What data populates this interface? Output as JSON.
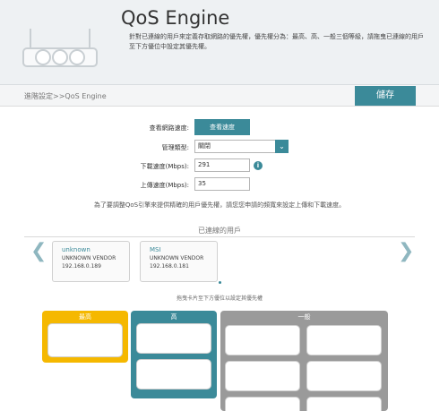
{
  "header": {
    "title": "QoS Engine",
    "description": "針對已連線的用戶來定義存取網路的優先權，優先權分為：最高、高、一般三個等級，請拖曳已連線的用戶至下方優位中設定其優先權。"
  },
  "breadcrumb": "進階設定>>QoS Engine",
  "toolbar": {
    "save_label": "儲存"
  },
  "form": {
    "check_speed_label": "查看網路速度:",
    "check_speed_button": "查看速度",
    "mgmt_type_label": "管理類型:",
    "mgmt_type_value": "關閉",
    "download_label": "下載速度(Mbps):",
    "download_value": "291",
    "upload_label": "上傳速度(Mbps):",
    "upload_value": "35",
    "note": "為了要調整QoS引擎來提供精確的用戶優先權，請您您申請的頻寬來設定上傳和下載速度。"
  },
  "clients": {
    "title": "已連線的用戶",
    "items": [
      {
        "name": "unknown",
        "vendor": "UNKNOWN VENDOR",
        "ip": "192.168.0.189"
      },
      {
        "name": "MSI",
        "vendor": "UNKNOWN VENDOR",
        "ip": "192.168.0.181"
      }
    ],
    "drag_hint": "拖曳卡片至下方優位以設定其優先權"
  },
  "priorities": {
    "highest": "最高",
    "high": "高",
    "normal": "一般"
  },
  "colors": {
    "accent": "#3b8a99",
    "highest": "#f5b800",
    "high": "#3b8a99",
    "normal": "#9a9a9a"
  },
  "icons": {
    "prev": "chevron-left-icon",
    "next": "chevron-right-icon",
    "info": "info-icon",
    "dropdown": "chevron-down-icon",
    "router": "router-icon"
  }
}
